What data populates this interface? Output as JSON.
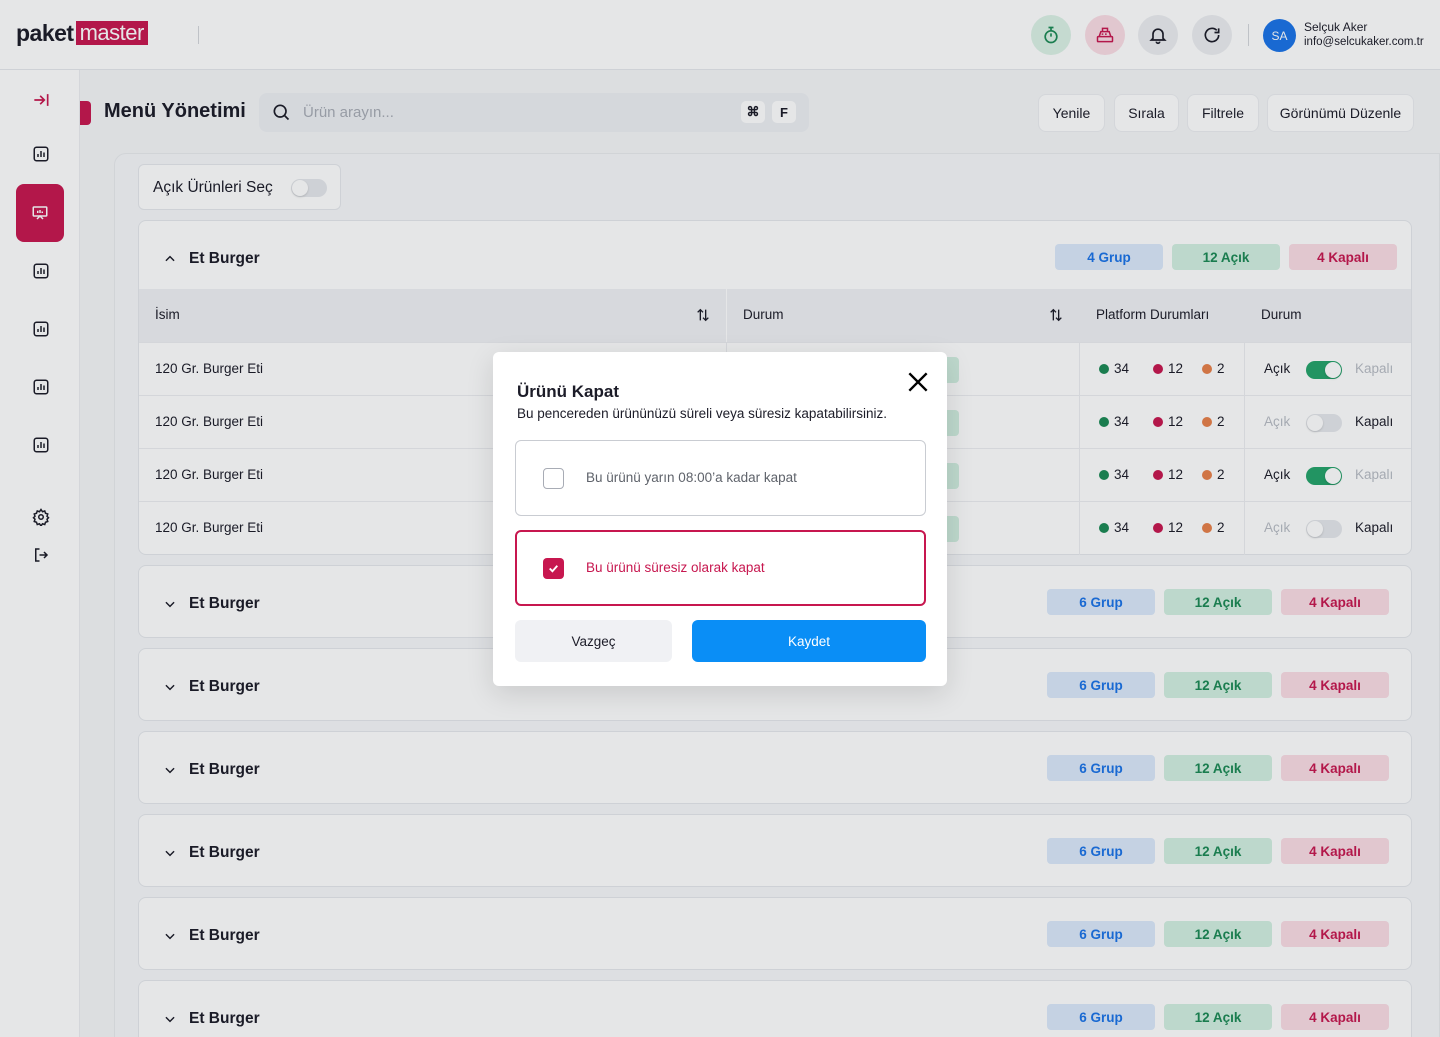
{
  "brand": {
    "part1": "pa",
    "part1b": "ket",
    "part2": "master",
    "accent": "#c7174f"
  },
  "topbar": {
    "icons": [
      "stopwatch-icon",
      "cash-register-icon",
      "bell-icon",
      "refresh-icon"
    ],
    "user": {
      "initials": "SA",
      "name": "Selçuk Aker",
      "email": "info@selcukaker.com.tr"
    }
  },
  "sidebar": {
    "items": [
      "collapse-icon",
      "chart-icon",
      "presentation-icon",
      "chart-icon",
      "chart-icon",
      "chart-icon",
      "chart-icon",
      "settings-icon",
      "logout-icon"
    ]
  },
  "header": {
    "title": "Menü Yönetimi",
    "search_placeholder": "Ürün arayın...",
    "shortcut_key1": "⌘",
    "shortcut_key2": "F",
    "buttons": [
      "Yenile",
      "Sırala",
      "Filtrele",
      "Görünümü Düzenle"
    ]
  },
  "filter": {
    "label": "Açık Ürünleri Seç",
    "on": false
  },
  "table": {
    "columns": [
      "İsim",
      "Durum",
      "Platform Durumları",
      "Durum"
    ],
    "open_label": "Açık",
    "closed_label": "Kapalı"
  },
  "groups": [
    {
      "title": "Et Burger",
      "expanded": true,
      "badges": [
        "4 Grup",
        "12 Açık",
        "4 Kapalı"
      ],
      "rows": [
        {
          "name": "120 Gr. Burger Eti",
          "green": "34",
          "red": "12",
          "orange": "2",
          "open": true
        },
        {
          "name": "120 Gr. Burger Eti",
          "green": "34",
          "red": "12",
          "orange": "2",
          "open": false
        },
        {
          "name": "120 Gr. Burger Eti",
          "green": "34",
          "red": "12",
          "orange": "2",
          "open": true
        },
        {
          "name": "120 Gr. Burger Eti",
          "green": "34",
          "red": "12",
          "orange": "2",
          "open": false
        }
      ]
    },
    {
      "title": "Et Burger",
      "expanded": false,
      "badges": [
        "6 Grup",
        "12 Açık",
        "4 Kapalı"
      ]
    },
    {
      "title": "Et Burger",
      "expanded": false,
      "badges": [
        "6 Grup",
        "12 Açık",
        "4 Kapalı"
      ]
    },
    {
      "title": "Et Burger",
      "expanded": false,
      "badges": [
        "6 Grup",
        "12 Açık",
        "4 Kapalı"
      ]
    },
    {
      "title": "Et Burger",
      "expanded": false,
      "badges": [
        "6 Grup",
        "12 Açık",
        "4 Kapalı"
      ]
    },
    {
      "title": "Et Burger",
      "expanded": false,
      "badges": [
        "6 Grup",
        "12 Açık",
        "4 Kapalı"
      ]
    },
    {
      "title": "Et Burger",
      "expanded": false,
      "badges": [
        "6 Grup",
        "12 Açık",
        "4 Kapalı"
      ]
    }
  ],
  "modal": {
    "title": "Ürünü Kapat",
    "subtitle": "Bu pencereden ürününüzü süreli veya süresiz kapatabilirsiniz.",
    "option1": "Bu ürünü yarın 08:00’a kadar kapat",
    "option1_checked": false,
    "option2": "Bu ürünü süresiz olarak kapat",
    "option2_checked": true,
    "cancel": "Vazgeç",
    "save": "Kaydet"
  },
  "colors": {
    "primary": "#c7174f",
    "save_button": "#0a8ef6",
    "open_green": "#24a36a"
  }
}
